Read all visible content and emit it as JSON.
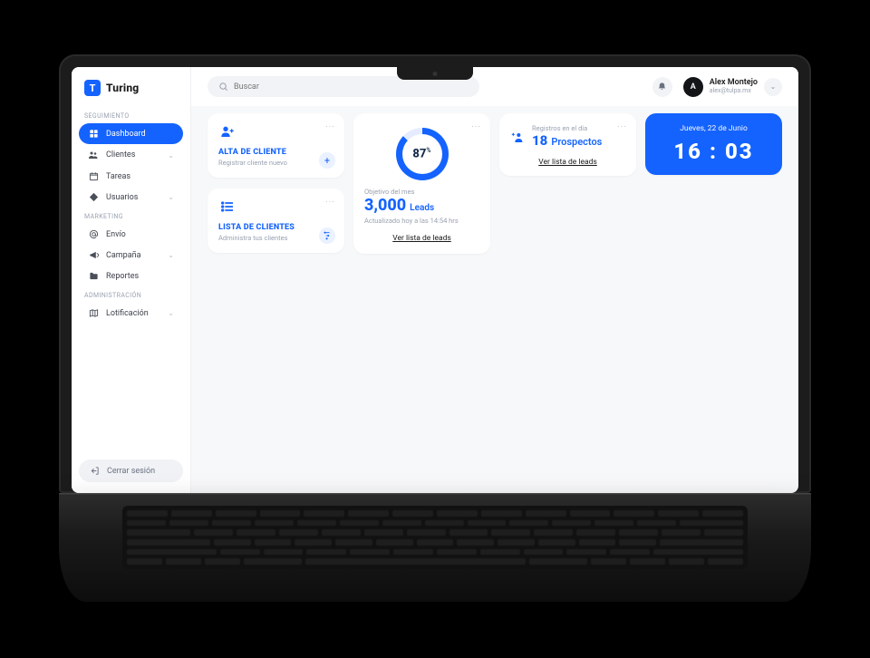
{
  "brand": {
    "mark": "T",
    "name": "Turing"
  },
  "search": {
    "placeholder": "Buscar"
  },
  "user": {
    "initial": "A",
    "name": "Alex Montejo",
    "email": "alex@tulpa.mx"
  },
  "sidebar": {
    "sections": [
      {
        "label": "SEGUIMIENTO",
        "items": [
          {
            "key": "dashboard",
            "label": "Dashboard",
            "icon": "grid",
            "active": true
          },
          {
            "key": "clientes",
            "label": "Clientes",
            "icon": "people",
            "chevron": true
          },
          {
            "key": "tareas",
            "label": "Tareas",
            "icon": "calendar"
          },
          {
            "key": "usuarios",
            "label": "Usuarios",
            "icon": "diamond",
            "chevron": true
          }
        ]
      },
      {
        "label": "MARKETING",
        "items": [
          {
            "key": "envio",
            "label": "Envío",
            "icon": "at"
          },
          {
            "key": "campana",
            "label": "Campaña",
            "icon": "megaphone",
            "chevron": true
          },
          {
            "key": "reportes",
            "label": "Reportes",
            "icon": "folder"
          }
        ]
      },
      {
        "label": "ADMINISTRACIÓN",
        "items": [
          {
            "key": "lotificacion",
            "label": "Lotificación",
            "icon": "map",
            "chevron": true
          }
        ]
      }
    ],
    "logout": "Cerrar sesión"
  },
  "cards": {
    "alta": {
      "title": "ALTA DE CLIENTE",
      "sub": "Registrar cliente nuevo"
    },
    "lista": {
      "title": "LISTA DE CLIENTES",
      "sub": "Administra tus clientes"
    },
    "goal": {
      "percent": "87",
      "label": "Objetivo del mes",
      "value": "3,000",
      "unit": "Leads",
      "updated": "Actualizado hoy a las 14:54 hrs",
      "link": "Ver lista de leads"
    },
    "prospects": {
      "meta": "Registros en el día",
      "count": "18",
      "unit": "Prospectos",
      "link": "Ver lista de leads"
    },
    "clock": {
      "date": "Jueves, 22 de Junio",
      "time": "16 : 03"
    }
  }
}
